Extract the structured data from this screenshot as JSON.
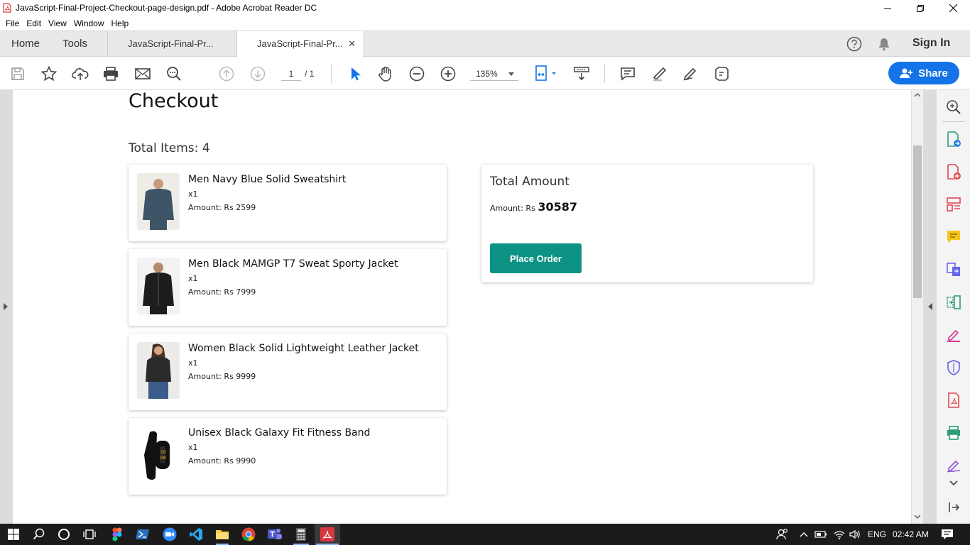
{
  "window": {
    "title": "JavaScript-Final-Project-Checkout-page-design.pdf - Adobe Acrobat Reader DC"
  },
  "menu": [
    "File",
    "Edit",
    "View",
    "Window",
    "Help"
  ],
  "tabs": {
    "home": "Home",
    "tools": "Tools",
    "documents": [
      {
        "label": "JavaScript-Final-Pr...",
        "active": false
      },
      {
        "label": "JavaScript-Final-Pr...",
        "active": true
      }
    ],
    "close_glyph": "✕",
    "sign_in": "Sign In"
  },
  "toolbar": {
    "page_current": "1",
    "page_total": "/  1",
    "zoom": "135%",
    "share_label": "Share",
    "icons": [
      "save-icon",
      "star-icon",
      "upload-icon",
      "print-icon",
      "mail-icon",
      "find-icon",
      "page-up-icon",
      "page-down-icon",
      "select-tool-icon",
      "hand-tool-icon",
      "zoom-out-icon",
      "zoom-in-icon",
      "page-fit-icon",
      "read-mode-icon",
      "comment-icon",
      "highlight-icon",
      "sign-icon",
      "more-tools-icon"
    ]
  },
  "document": {
    "title": "Checkout",
    "total_items": "Total Items: 4",
    "items": [
      {
        "name": "Men Navy Blue Solid Sweatshirt",
        "qty": "x1",
        "amount": "Amount: Rs 2599",
        "thumb_color": "#3d5566"
      },
      {
        "name": "Men Black MAMGP T7 Sweat Sporty Jacket",
        "qty": "x1",
        "amount": "Amount: Rs 7999",
        "thumb_color": "#1d1d1d"
      },
      {
        "name": "Women Black Solid Lightweight Leather Jacket",
        "qty": "x1",
        "amount": "Amount: Rs 9999",
        "thumb_color": "#2a2a2a"
      },
      {
        "name": "Unisex Black Galaxy Fit Fitness Band",
        "qty": "x1",
        "amount": "Amount: Rs 9990",
        "thumb_color": "#111111"
      }
    ],
    "summary": {
      "title": "Total Amount",
      "amount_prefix": "Amount: Rs",
      "amount_value": "30587",
      "button": "Place Order"
    }
  },
  "taskbar": {
    "language": "ENG",
    "time": "02:42 AM"
  },
  "colors": {
    "accent": "#1473e6",
    "place_order": "#0c9384"
  }
}
